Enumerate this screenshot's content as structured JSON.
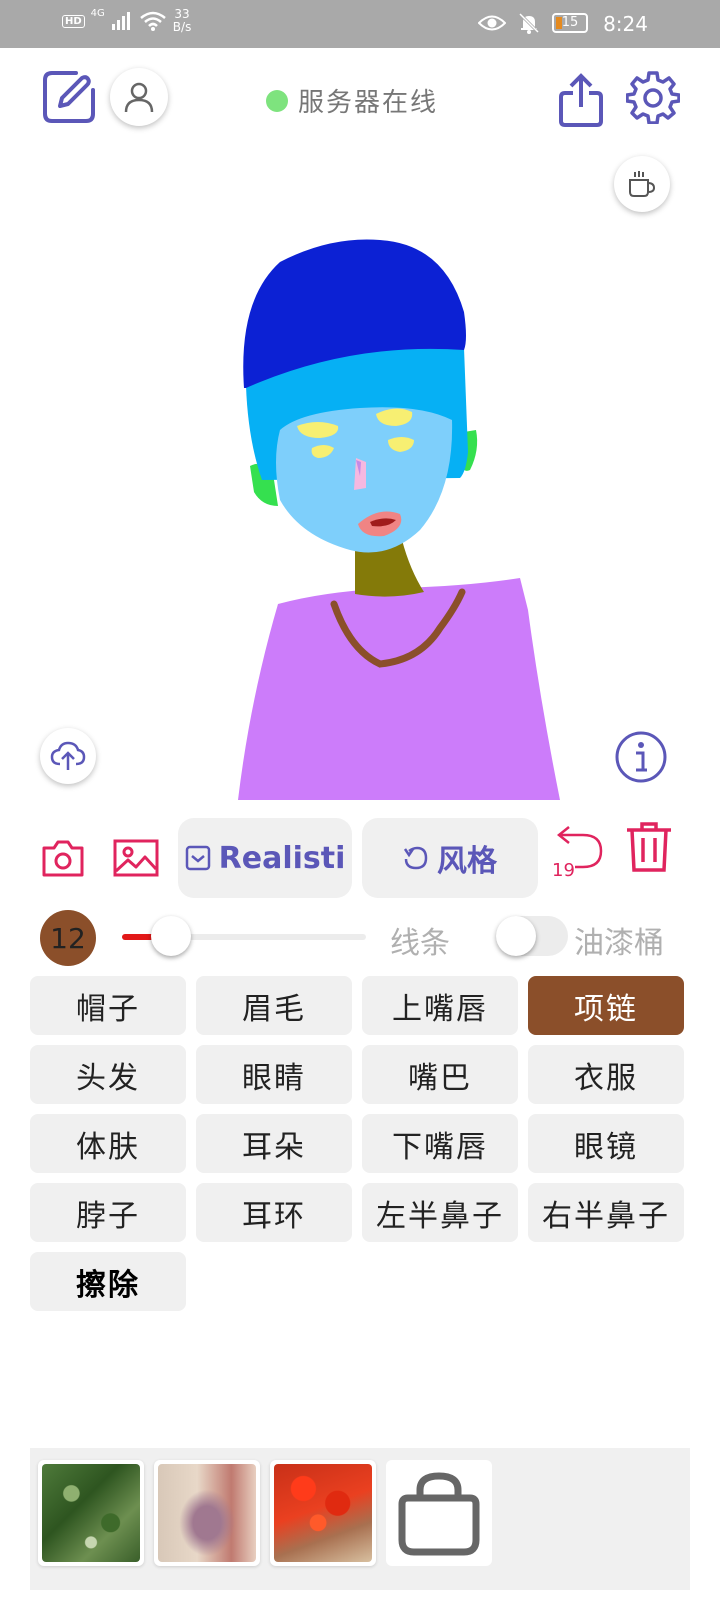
{
  "status_bar": {
    "hd": "HD",
    "network": "4G",
    "speed_value": "33",
    "speed_unit": "B/s",
    "battery": "15",
    "time": "8:24"
  },
  "header": {
    "server_status": "服务器在线",
    "server_status_color": "#7ee37e",
    "accent_color": "#5b57b8"
  },
  "toolbar": {
    "realistic_label": "Realisti",
    "style_label": "风格",
    "undo_count": "19",
    "icon_color": "#e0245e"
  },
  "brush": {
    "size": "12",
    "slider_fraction": 0.2,
    "line_label": "线条",
    "bucket_label": "油漆桶",
    "bucket_enabled": false
  },
  "parts": [
    {
      "label": "帽子",
      "active": false,
      "bold": false
    },
    {
      "label": "眉毛",
      "active": false,
      "bold": false
    },
    {
      "label": "上嘴唇",
      "active": false,
      "bold": false
    },
    {
      "label": "项链",
      "active": true,
      "bold": false
    },
    {
      "label": "头发",
      "active": false,
      "bold": false
    },
    {
      "label": "眼睛",
      "active": false,
      "bold": false
    },
    {
      "label": "嘴巴",
      "active": false,
      "bold": false
    },
    {
      "label": "衣服",
      "active": false,
      "bold": false
    },
    {
      "label": "体肤",
      "active": false,
      "bold": false
    },
    {
      "label": "耳朵",
      "active": false,
      "bold": false
    },
    {
      "label": "下嘴唇",
      "active": false,
      "bold": false
    },
    {
      "label": "眼镜",
      "active": false,
      "bold": false
    },
    {
      "label": "脖子",
      "active": false,
      "bold": false
    },
    {
      "label": "耳环",
      "active": false,
      "bold": false
    },
    {
      "label": "左半鼻子",
      "active": false,
      "bold": false
    },
    {
      "label": "右半鼻子",
      "active": false,
      "bold": false
    },
    {
      "label": "擦除",
      "active": false,
      "bold": true
    }
  ],
  "style_thumbnails": [
    "green-foliage-style",
    "pink-texture-style",
    "red-flowers-style",
    "shop-bag-icon"
  ]
}
